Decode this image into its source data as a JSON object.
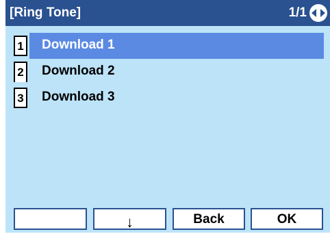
{
  "title": {
    "label": "[Ring Tone]",
    "page": "1/1",
    "nav_icon": "left-right-arrows-icon"
  },
  "menu": {
    "items": [
      {
        "number": "1",
        "label": "Download 1",
        "selected": true
      },
      {
        "number": "2",
        "label": "Download 2",
        "selected": false
      },
      {
        "number": "3",
        "label": "Download 3",
        "selected": false
      }
    ]
  },
  "softkeys": {
    "key1": "",
    "key2": "↓",
    "key3": "Back",
    "key4": "OK"
  },
  "colors": {
    "titlebar": "#2a5190",
    "background": "#bde3f8",
    "selection": "#5b8ae3"
  }
}
